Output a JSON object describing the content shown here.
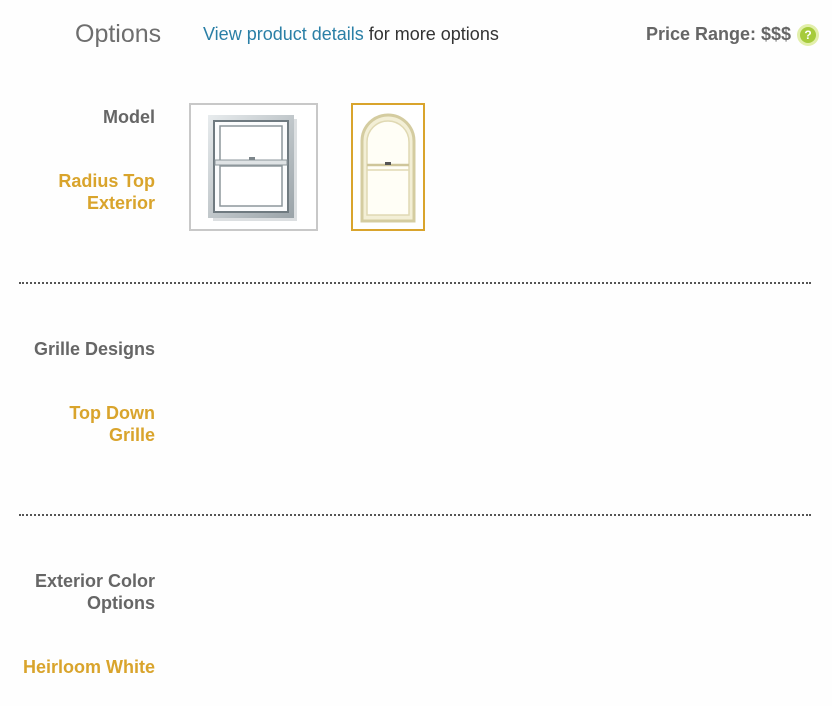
{
  "header": {
    "title": "Options",
    "details_link": "View product details",
    "details_suffix": " for more options",
    "price_range": "Price Range: $$$",
    "help_glyph": "?"
  },
  "sections": {
    "model": {
      "label": "Model",
      "selected_line1": "Radius Top",
      "selected_line2": "Exterior",
      "options": [
        {
          "icon": "double-hung-window-icon",
          "selected": false
        },
        {
          "icon": "radius-top-window-icon",
          "selected": true
        }
      ]
    },
    "grille": {
      "label": "Grille Designs",
      "selected_line1": "Top Down",
      "selected_line2": "Grille"
    },
    "exterior_color": {
      "label_line1": "Exterior Color",
      "label_line2": "Options",
      "selected": "Heirloom White"
    }
  },
  "colors": {
    "accent": "#d9a42c",
    "link": "#2a7fa6",
    "help_icon": "#a6cb3c"
  }
}
